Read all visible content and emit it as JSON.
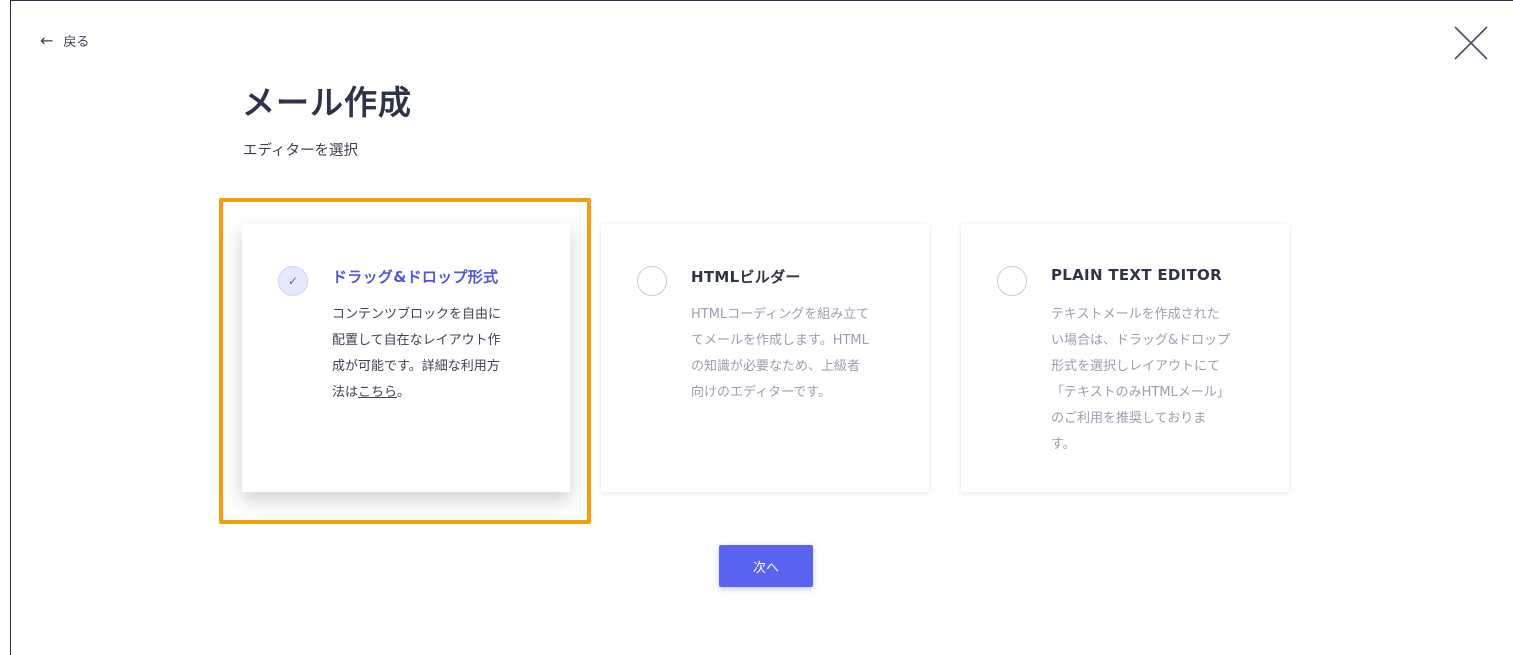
{
  "nav": {
    "back_arrow": "←",
    "back_label": "戻る",
    "close_icon": "close-icon"
  },
  "header": {
    "title": "メール作成",
    "subtitle": "エディターを選択"
  },
  "options": [
    {
      "title": "ドラッグ&ドロップ形式",
      "selected": true,
      "desc_lines": [
        "コンテンツブロックを自由に",
        "配置して自在なレイアウト作",
        "成が可能です。詳細な利用方"
      ],
      "desc_last_prefix": "法は",
      "desc_link": "こちら",
      "desc_last_suffix": "。"
    },
    {
      "title": "HTMLビルダー",
      "selected": false,
      "desc_lines": [
        "HTMLコーディングを組み立て",
        "てメールを作成します。HTML",
        "の知識が必要なため、上級者",
        "向けのエディターです。"
      ]
    },
    {
      "title": "PLAIN TEXT EDITOR",
      "selected": false,
      "desc_lines": [
        "テキストメールを作成された",
        "い場合は、ドラッグ&ドロップ",
        "形式を選択しレイアウトにて",
        "「テキストのみHTMLメール」",
        "のご利用を推奨しておりま",
        "す。"
      ]
    }
  ],
  "footer": {
    "next_label": "次へ"
  },
  "colors": {
    "accent": "#5a62f0",
    "highlight": "#f59e0b"
  }
}
